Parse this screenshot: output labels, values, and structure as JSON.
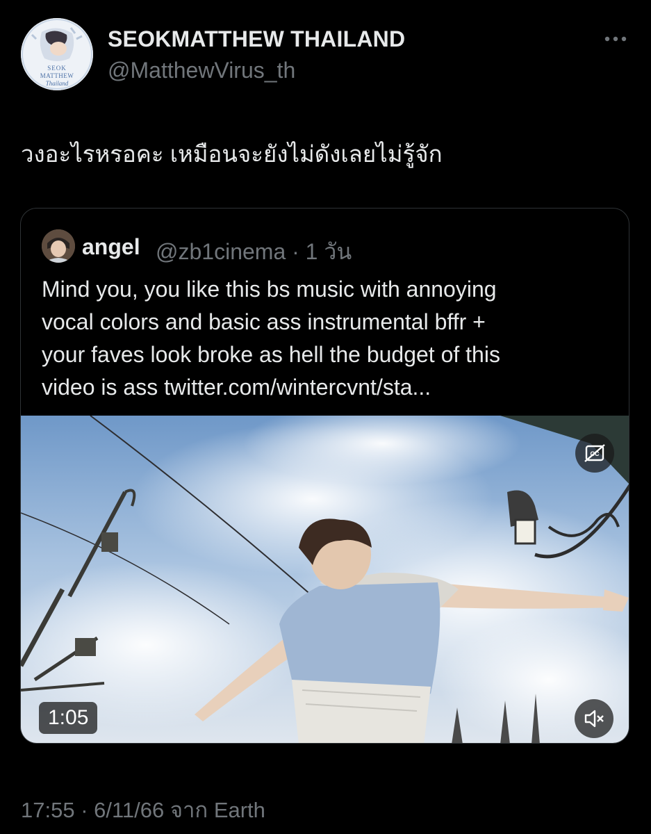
{
  "tweet": {
    "author": {
      "display_name": "SEOKMATTHEW THAILAND",
      "handle": "@MatthewVirus_th",
      "avatar_text": [
        "SEOK",
        "MATTHEW",
        "Thailand"
      ]
    },
    "text": "วงอะไรหรอคะ เหมือนจะยังไม่ดังเลยไม่รู้จัก",
    "more_icon": "more-horizontal-icon",
    "timestamp": "17:55 · 6/11/66 จาก Earth"
  },
  "quoted_tweet": {
    "author_name": "angel",
    "handle_time": "@zb1cinema · 1 วัน",
    "text_lines": [
      "Mind you, you like this bs music with annoying",
      "vocal colors and basic ass instrumental bffr +",
      "your faves look broke as hell the budget of this",
      "video is ass twitter.com/wintercvnt/sta..."
    ],
    "video": {
      "duration": "1:05",
      "captions_icon": "closed-captions-off-icon",
      "mute_icon": "volume-muted-icon"
    }
  },
  "colors": {
    "background": "#000000",
    "primary_text": "#e7e9ea",
    "secondary_text": "#71767b",
    "border": "#2f3336"
  }
}
